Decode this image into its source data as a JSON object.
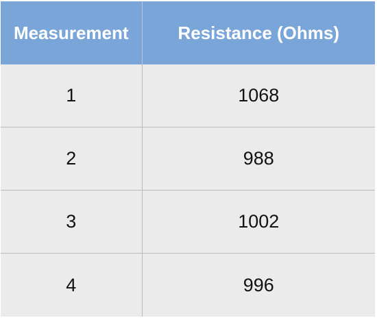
{
  "table": {
    "headers": [
      "Measurement",
      "Resistance (Ohms)"
    ],
    "rows": [
      [
        "1",
        "1068"
      ],
      [
        "2",
        "988"
      ],
      [
        "3",
        "1002"
      ],
      [
        "4",
        "996"
      ]
    ]
  },
  "colors": {
    "header_bg": "#79a5d8",
    "header_text": "#ffffff",
    "cell_bg": "#ebebeb"
  }
}
